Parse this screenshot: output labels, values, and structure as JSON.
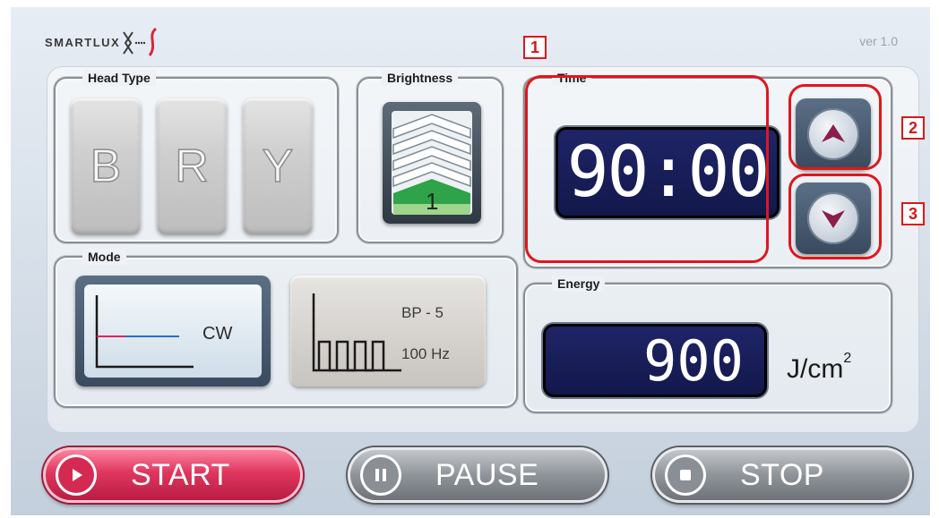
{
  "header": {
    "logo_text": "SMARTLUX",
    "version": "ver 1.0"
  },
  "head_type": {
    "label": "Head Type",
    "buttons": [
      "B",
      "R",
      "Y"
    ]
  },
  "brightness": {
    "label": "Brightness",
    "level": "1"
  },
  "time": {
    "label": "Time",
    "value": "90:00"
  },
  "mode": {
    "label": "Mode",
    "cw_label": "CW",
    "bp_line1": "BP - 5",
    "bp_line2": "100 Hz"
  },
  "energy": {
    "label": "Energy",
    "value": "900",
    "unit": "J/cm",
    "unit_exp": "2"
  },
  "actions": {
    "start": "START",
    "pause": "PAUSE",
    "stop": "STOP"
  },
  "annotations": [
    "1",
    "2",
    "3"
  ],
  "colors": {
    "annotation": "#e0161b",
    "display_bg": "#1b2160",
    "start_red": "#e0365e",
    "brightness_green": "#2fa34a"
  },
  "icons": [
    "up-arrow-icon",
    "down-arrow-icon",
    "play-icon",
    "pause-icon",
    "stop-icon",
    "brightness-chevrons-icon",
    "cw-waveform-icon",
    "pulse-waveform-icon"
  ]
}
